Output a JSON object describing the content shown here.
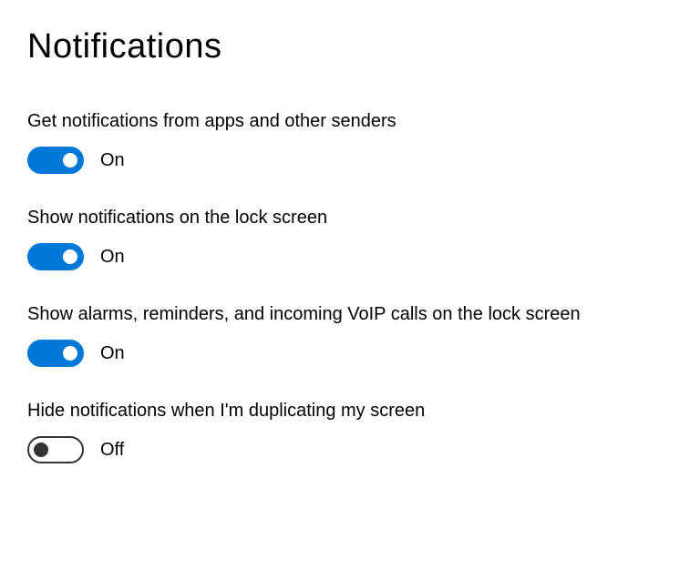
{
  "title": "Notifications",
  "settings": [
    {
      "label": "Get notifications from apps and other senders",
      "state": "on",
      "status": "On"
    },
    {
      "label": "Show notifications on the lock screen",
      "state": "on",
      "status": "On"
    },
    {
      "label": "Show alarms, reminders, and incoming VoIP calls on the lock screen",
      "state": "on",
      "status": "On"
    },
    {
      "label": "Hide notifications when I'm duplicating my screen",
      "state": "off",
      "status": "Off"
    }
  ]
}
